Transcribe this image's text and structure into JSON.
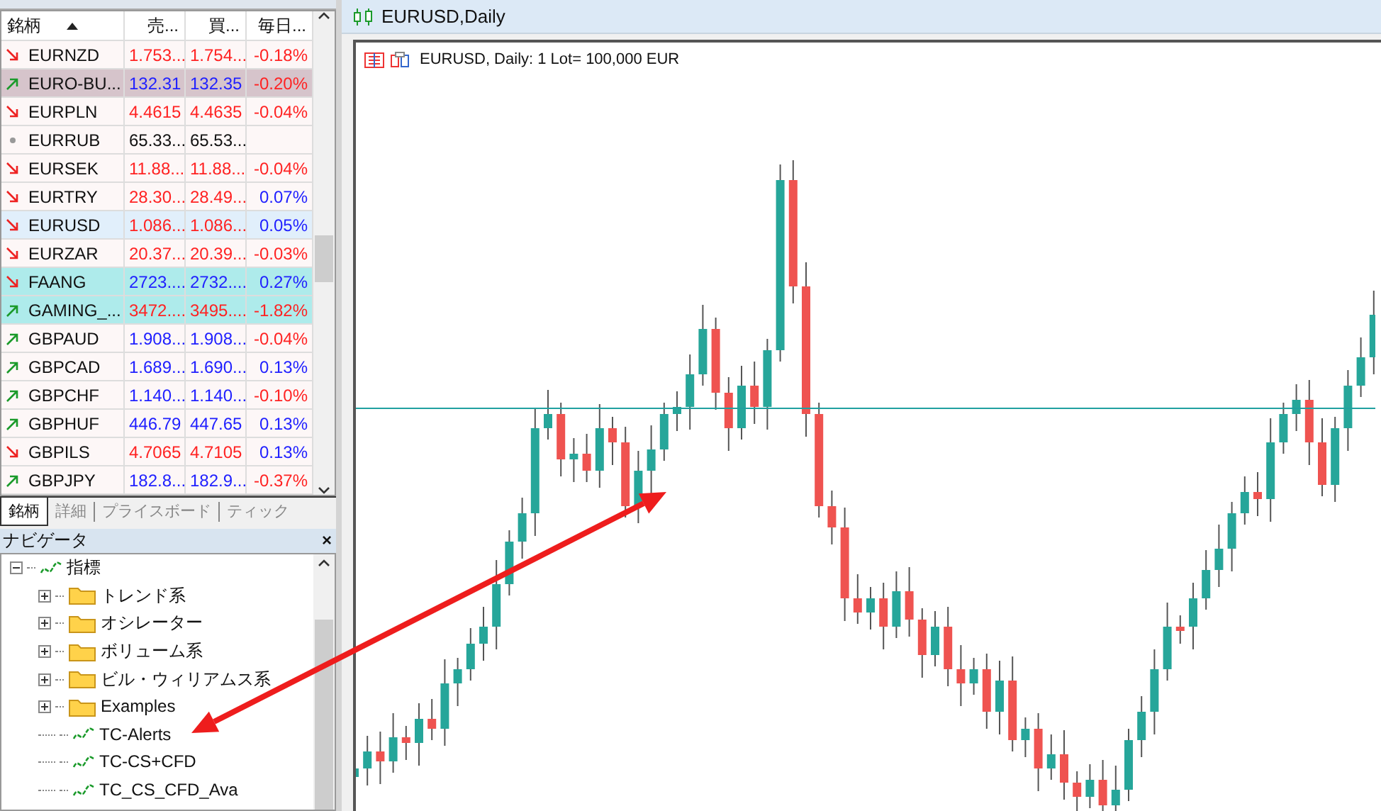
{
  "market_watch": {
    "columns": [
      {
        "label": "銘柄",
        "sorted": true
      },
      {
        "label": "売..."
      },
      {
        "label": "買..."
      },
      {
        "label": "毎日..."
      }
    ],
    "rows": [
      {
        "symbol": "EURNZD",
        "kind": "down",
        "bid": {
          "text": "1.753...",
          "color": "#ff2222"
        },
        "ask": {
          "text": "1.754...",
          "color": "#ff2222"
        },
        "change": {
          "text": "-0.18%",
          "color": "#ff2222"
        },
        "color": "#fdf7f7"
      },
      {
        "symbol": "EURO-BU...",
        "kind": "up",
        "bid": {
          "text": "132.31",
          "color": "#2020ff"
        },
        "ask": {
          "text": "132.35",
          "color": "#2020ff"
        },
        "change": {
          "text": "-0.20%",
          "color": "#ff2222"
        },
        "color": "#d6c4cb"
      },
      {
        "symbol": "EURPLN",
        "kind": "down",
        "bid": {
          "text": "4.4615",
          "color": "#ff2222"
        },
        "ask": {
          "text": "4.4635",
          "color": "#ff2222"
        },
        "change": {
          "text": "-0.04%",
          "color": "#ff2222"
        },
        "color": "#fdf7f7"
      },
      {
        "symbol": "EURRUB",
        "kind": "flat",
        "bid": {
          "text": "65.33...",
          "color": "#111111"
        },
        "ask": {
          "text": "65.53...",
          "color": "#111111"
        },
        "color": "#fdf7f7"
      },
      {
        "symbol": "EURSEK",
        "kind": "down",
        "bid": {
          "text": "11.88...",
          "color": "#ff2222"
        },
        "ask": {
          "text": "11.88...",
          "color": "#ff2222"
        },
        "change": {
          "text": "-0.04%",
          "color": "#ff2222"
        },
        "color": "#fdf7f7"
      },
      {
        "symbol": "EURTRY",
        "kind": "down",
        "bid": {
          "text": "28.30...",
          "color": "#ff2222"
        },
        "ask": {
          "text": "28.49...",
          "color": "#ff2222"
        },
        "change": {
          "text": "0.07%",
          "color": "#2020ff"
        },
        "color": "#fdf7f7"
      },
      {
        "symbol": "EURUSD",
        "kind": "down",
        "bid": {
          "text": "1.086...",
          "color": "#ff2222"
        },
        "ask": {
          "text": "1.086...",
          "color": "#ff2222"
        },
        "change": {
          "text": "0.05%",
          "color": "#2020ff"
        },
        "color": "#e1effb"
      },
      {
        "symbol": "EURZAR",
        "kind": "down",
        "bid": {
          "text": "20.37...",
          "color": "#ff2222"
        },
        "ask": {
          "text": "20.39...",
          "color": "#ff2222"
        },
        "change": {
          "text": "-0.03%",
          "color": "#ff2222"
        },
        "color": "#fdf7f7"
      },
      {
        "symbol": "FAANG",
        "kind": "down",
        "bid": {
          "text": "2723....",
          "color": "#2020ff"
        },
        "ask": {
          "text": "2732....",
          "color": "#2020ff"
        },
        "change": {
          "text": "0.27%",
          "color": "#2020ff"
        },
        "color": "#aeebeb"
      },
      {
        "symbol": "GAMING_...",
        "kind": "up",
        "bid": {
          "text": "3472....",
          "color": "#ff2222"
        },
        "ask": {
          "text": "3495....",
          "color": "#ff2222"
        },
        "change": {
          "text": "-1.82%",
          "color": "#ff2222"
        },
        "color": "#aeebeb"
      },
      {
        "symbol": "GBPAUD",
        "kind": "up",
        "bid": {
          "text": "1.908...",
          "color": "#2020ff"
        },
        "ask": {
          "text": "1.908...",
          "color": "#2020ff"
        },
        "change": {
          "text": "-0.04%",
          "color": "#ff2222"
        },
        "color": "#fdf7f7"
      },
      {
        "symbol": "GBPCAD",
        "kind": "up",
        "bid": {
          "text": "1.689...",
          "color": "#2020ff"
        },
        "ask": {
          "text": "1.690...",
          "color": "#2020ff"
        },
        "change": {
          "text": "0.13%",
          "color": "#2020ff"
        },
        "color": "#fdf7f7"
      },
      {
        "symbol": "GBPCHF",
        "kind": "up",
        "bid": {
          "text": "1.140...",
          "color": "#2020ff"
        },
        "ask": {
          "text": "1.140...",
          "color": "#2020ff"
        },
        "change": {
          "text": "-0.10%",
          "color": "#ff2222"
        },
        "color": "#fdf7f7"
      },
      {
        "symbol": "GBPHUF",
        "kind": "up",
        "bid": {
          "text": "446.79",
          "color": "#2020ff"
        },
        "ask": {
          "text": "447.65",
          "color": "#2020ff"
        },
        "change": {
          "text": "0.13%",
          "color": "#2020ff"
        },
        "color": "#fdf7f7"
      },
      {
        "symbol": "GBPILS",
        "kind": "down",
        "bid": {
          "text": "4.7065",
          "color": "#ff2222"
        },
        "ask": {
          "text": "4.7105",
          "color": "#ff2222"
        },
        "change": {
          "text": "0.13%",
          "color": "#2020ff"
        },
        "color": "#fdf7f7"
      },
      {
        "symbol": "GBPJPY",
        "kind": "up",
        "bid": {
          "text": "182.8...",
          "color": "#2020ff"
        },
        "ask": {
          "text": "182.9...",
          "color": "#2020ff"
        },
        "change": {
          "text": "-0.37%",
          "color": "#ff2222"
        },
        "color": "#fdf7f7"
      }
    ],
    "tabs": [
      {
        "label": "銘柄",
        "selected": true
      },
      {
        "label": "詳細",
        "selected": false
      },
      {
        "label": "プライスボード",
        "selected": false
      },
      {
        "label": "ティック",
        "selected": false
      }
    ]
  },
  "navigator": {
    "title": "ナビゲータ",
    "close": "×",
    "tree": [
      {
        "label": "指標",
        "kind": "indicator",
        "expanded": true,
        "children": [
          {
            "label": "トレンド系",
            "kind": "folder",
            "expanded": false
          },
          {
            "label": "オシレーター",
            "kind": "folder",
            "expanded": false
          },
          {
            "label": "ボリューム系",
            "kind": "folder",
            "expanded": false
          },
          {
            "label": "ビル・ウィリアムス系",
            "kind": "folder",
            "expanded": false
          },
          {
            "label": "Examples",
            "kind": "folder",
            "expanded": false
          },
          {
            "label": "TC-Alerts",
            "kind": "indicator"
          },
          {
            "label": "TC-CS+CFD",
            "kind": "indicator"
          },
          {
            "label": "TC_CS_CFD_Ava",
            "kind": "indicator"
          }
        ]
      }
    ]
  },
  "chart_window": {
    "tab": "EURUSD,Daily",
    "label": "EURUSD, Daily:  1 Lot= 100,000 EUR"
  }
}
